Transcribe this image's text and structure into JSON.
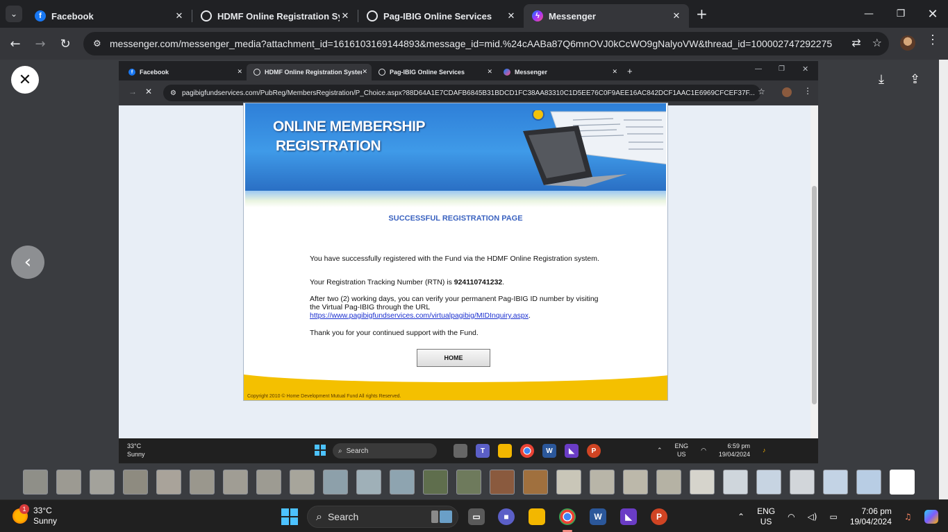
{
  "browser": {
    "tabs": [
      {
        "label": "Facebook",
        "icon": "facebook-icon"
      },
      {
        "label": "HDMF Online Registration System",
        "icon": "globe-icon"
      },
      {
        "label": "Pag-IBIG Online Services",
        "icon": "globe-icon"
      },
      {
        "label": "Messenger",
        "icon": "messenger-icon",
        "active": true
      }
    ],
    "url": "messenger.com/messenger_media?attachment_id=1616103169144893&message_id=mid.%24cAABa87Q6mnOVJ0kCcWO9gNalyoVW&thread_id=100002747292275"
  },
  "inner_browser": {
    "tabs": [
      {
        "label": "Facebook"
      },
      {
        "label": "HDMF Online Registration System",
        "active": true
      },
      {
        "label": "Pag-IBIG Online Services"
      },
      {
        "label": "Messenger"
      }
    ],
    "url": "pagibigfundservices.com/PubReg/MembersRegistration/P_Choice.aspx?88D64A1E7CDAFB6845B31BDCD1FC38AA83310C1D5EE76C0F9AEE16AC842DCF1AAC1E6969CFCEF37F..."
  },
  "page": {
    "banner_line1": "ONLINE MEMBERSHIP",
    "banner_line2": "REGISTRATION",
    "success_title": "SUCCESSFUL REGISTRATION PAGE",
    "p1": "You have successfully registered with the Fund via the HDMF Online Registration system.",
    "rtn_prefix": "Your Registration Tracking Number (RTN) is ",
    "rtn": "924110741232",
    "rtn_suffix": ".",
    "p3": "After two (2) working days, you can verify your permanent Pag-IBIG ID number by visiting the Virtual Pag-IBIG through the URL",
    "link": "https://www.pagibigfundservices.com/virtualpagibig/MIDInquiry.aspx",
    "link_suffix": ".",
    "p4": "Thank you for your continued support with the Fund.",
    "home_button": "HOME",
    "copyright": "Copyright 2010 © Home Development Mutual Fund All rights Reserved."
  },
  "inner_taskbar": {
    "temp": "33°C",
    "weather": "Sunny",
    "search": "Search",
    "lang1": "ENG",
    "lang2": "US",
    "time": "6:59 pm",
    "date": "19/04/2024"
  },
  "taskbar": {
    "temp": "33°C",
    "weather": "Sunny",
    "notification_count": "1",
    "search": "Search",
    "lang1": "ENG",
    "lang2": "US",
    "time": "7:06 pm",
    "date": "19/04/2024"
  },
  "colors": {
    "chrome_dark": "#202124",
    "chrome_toolbar": "#35363a",
    "banner_blue": "#3f9ae8",
    "success_text": "#3b63c0",
    "footer_yellow": "#f4c000",
    "link": "#1a2fcf"
  }
}
